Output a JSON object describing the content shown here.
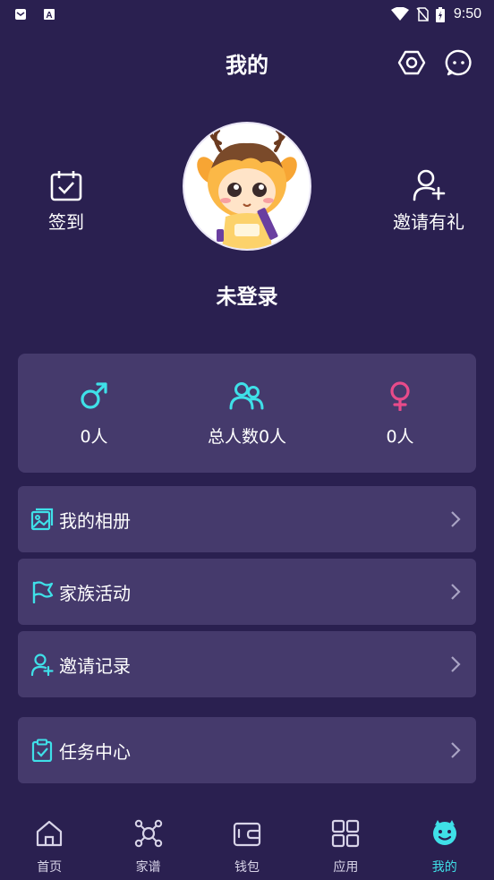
{
  "status_bar": {
    "time": "9:50"
  },
  "header": {
    "title": "我的"
  },
  "profile": {
    "checkin_label": "签到",
    "invite_label": "邀请有礼",
    "username": "未登录"
  },
  "stats": [
    {
      "value": "0人",
      "icon": "male-icon",
      "color": "#3fe0e8"
    },
    {
      "value": "总人数0人",
      "icon": "people-icon",
      "color": "#3fe0e8"
    },
    {
      "value": "0人",
      "icon": "female-icon",
      "color": "#e84b8a"
    }
  ],
  "menu": [
    {
      "label": "我的相册",
      "icon": "album-icon"
    },
    {
      "label": "家族活动",
      "icon": "flag-icon"
    },
    {
      "label": "邀请记录",
      "icon": "user-add-icon"
    },
    {
      "label": "任务中心",
      "icon": "clipboard-check-icon"
    }
  ],
  "tabs": [
    {
      "label": "首页",
      "icon": "home-icon"
    },
    {
      "label": "家谱",
      "icon": "family-tree-icon"
    },
    {
      "label": "钱包",
      "icon": "wallet-icon"
    },
    {
      "label": "应用",
      "icon": "apps-icon"
    },
    {
      "label": "我的",
      "icon": "smiley-icon",
      "active": true
    }
  ],
  "colors": {
    "background": "#2a2050",
    "card": "#453a6c",
    "accent": "#3fe0e8",
    "female": "#e84b8a"
  }
}
